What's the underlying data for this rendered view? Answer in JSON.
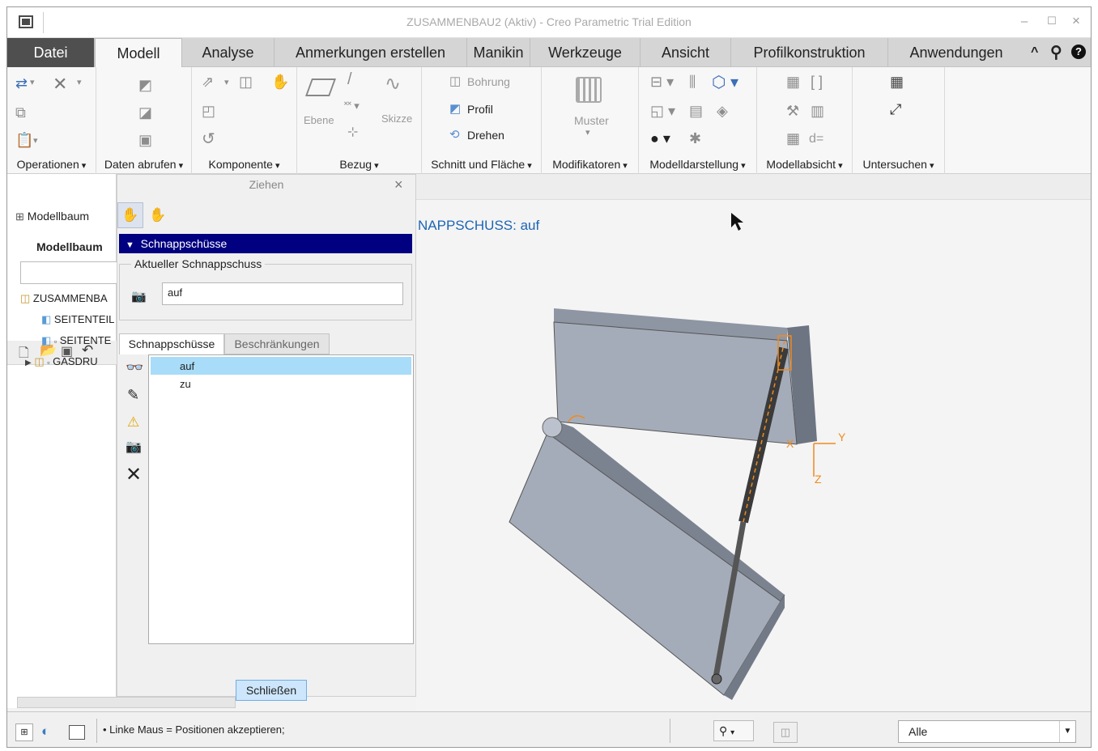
{
  "window": {
    "title": "ZUSAMMENBAU2 (Aktiv) - Creo Parametric Trial Edition",
    "minimize": "–",
    "maximize": "☐",
    "close": "×"
  },
  "tabs": [
    {
      "label": "Datei"
    },
    {
      "label": "Modell"
    },
    {
      "label": "Analyse"
    },
    {
      "label": "Anmerkungen erstellen"
    },
    {
      "label": "Manikin"
    },
    {
      "label": "Werkzeuge"
    },
    {
      "label": "Ansicht"
    },
    {
      "label": "Profilkonstruktion"
    },
    {
      "label": "Anwendungen"
    }
  ],
  "tab_icons": {
    "collapse": "^",
    "search": "⚲",
    "help": "?"
  },
  "ribbon": {
    "groups": {
      "operationen": "Operationen",
      "daten": "Daten abrufen",
      "komponente": "Komponente",
      "bezug": "Bezug",
      "schnitt": "Schnitt und Fläche",
      "modifikatoren": "Modifikatoren",
      "darstellung": "Modelldarstellung",
      "absicht": "Modellabsicht",
      "untersuchen": "Untersuchen"
    },
    "ebene": "Ebene",
    "skizze": "Skizze",
    "bohrung": "Bohrung",
    "profil": "Profil",
    "drehen": "Drehen",
    "muster": "Muster",
    "d_eq": "d="
  },
  "tree": {
    "header": "Modellbaum",
    "tab_label": "Modellbaum",
    "items": [
      {
        "label": "ZUSAMMENBA"
      },
      {
        "label": "SEITENTEIL"
      },
      {
        "label": "SEITENTE"
      },
      {
        "label": "GASDRU"
      }
    ]
  },
  "dialog": {
    "title": "Ziehen",
    "section_header": "Schnappschüsse",
    "current_label": "Aktueller Schnappschuss",
    "current_value": "auf",
    "tabs": [
      {
        "label": "Schnappschüsse"
      },
      {
        "label": "Beschränkungen"
      }
    ],
    "list": [
      "auf",
      "zu"
    ],
    "close_button": "Schließen"
  },
  "viewport": {
    "snapshot_text": "NAPPSCHUSS: auf",
    "axes": {
      "x": "X",
      "y": "Y",
      "z": "Z"
    }
  },
  "status": {
    "message": "• Linke Maus = Positionen akzeptieren;",
    "filter_value": "Alle"
  },
  "colors": {
    "accent_blue": "#1c65b4",
    "selected_row": "#a8dcf8",
    "section_header": "#000080",
    "model_gray": "#a5acb9",
    "orange": "#f08a1e"
  }
}
